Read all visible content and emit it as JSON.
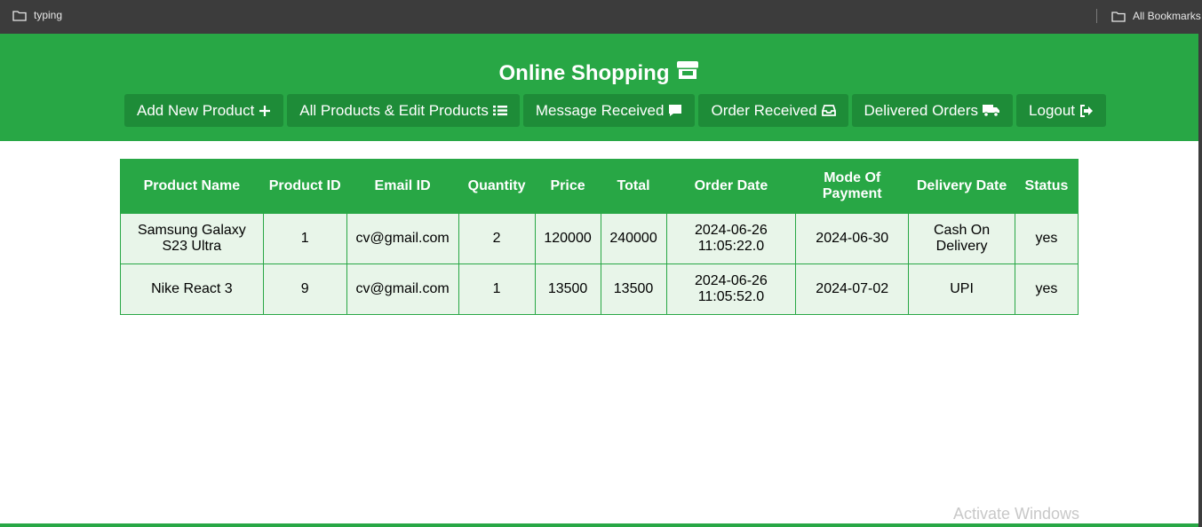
{
  "bookmarks": {
    "left_label": "typing",
    "right_label": "All Bookmarks"
  },
  "header": {
    "title": "Online Shopping",
    "nav": [
      {
        "label": "Add New Product",
        "icon": "plus-icon"
      },
      {
        "label": "All Products & Edit Products",
        "icon": "list-icon"
      },
      {
        "label": "Message Received",
        "icon": "comment-icon"
      },
      {
        "label": "Order Received",
        "icon": "inbox-icon"
      },
      {
        "label": "Delivered Orders",
        "icon": "truck-icon"
      },
      {
        "label": "Logout",
        "icon": "sign-out-icon"
      }
    ]
  },
  "table": {
    "headers": [
      "Product Name",
      "Product ID",
      "Email ID",
      "Quantity",
      "Price",
      "Total",
      "Order Date",
      "Mode Of Payment",
      "Delivery Date",
      "Status"
    ],
    "rows": [
      [
        "Samsung Galaxy S23 Ultra",
        "1",
        "cv@gmail.com",
        "2",
        "120000",
        "240000",
        "2024-06-26 11:05:22.0",
        "2024-06-30",
        "Cash On Delivery",
        "yes"
      ],
      [
        "Nike React 3",
        "9",
        "cv@gmail.com",
        "1",
        "13500",
        "13500",
        "2024-06-26 11:05:52.0",
        "2024-07-02",
        "UPI",
        "yes"
      ]
    ]
  },
  "watermark": "Activate Windows",
  "colors": {
    "primary": "#28a745",
    "button": "#1e8c38",
    "cell_bg": "#e8f5e9",
    "bookmarks_bar": "#3c3c3c"
  }
}
